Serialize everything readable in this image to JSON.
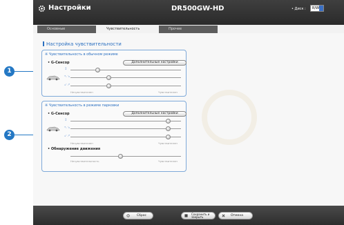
{
  "header": {
    "title": "Настройки",
    "model": "DR500GW-HD",
    "disk_label": "• Диск :",
    "disk_value": "R/W"
  },
  "tabs": [
    {
      "label": "Основные",
      "active": false
    },
    {
      "label": "Чувствительность",
      "active": true
    },
    {
      "label": "Прочее",
      "active": false
    }
  ],
  "page_title": "Настройка чувствительности",
  "panel_normal": {
    "title": "※ Чувствительность в обычном режиме",
    "gsensor_label": "• G-Сенсор",
    "advanced_button": "Дополнительные настройки",
    "axes": [
      "↕",
      "↖↘",
      "↙↗"
    ],
    "levels": [
      0.2,
      0.3,
      0.3
    ],
    "scale_low": "Нечувствителен",
    "scale_high": "Чувствителен"
  },
  "panel_parking": {
    "title": "※ Чувствительность в режиме парковки",
    "gsensor_label": "• G-Сенсор",
    "advanced_button": "Дополнительные настройки",
    "axes": [
      "↕",
      "↖↘",
      "↙↗"
    ],
    "levels": [
      0.85,
      0.85,
      0.85
    ],
    "scale_low": "Нечувствителен",
    "scale_high": "Чувствителен",
    "motion_label": "• Обнаружение движения",
    "motion_level": 0.45,
    "motion_scale_low": "Нечувствительность",
    "motion_scale_high": "Чувствителен"
  },
  "callouts": [
    "1",
    "2"
  ],
  "footer": {
    "reset": "Сброс",
    "save": "Сохранить и закрыть",
    "cancel": "Отмена"
  },
  "colors": {
    "accent": "#2a6fc0",
    "callout": "#2478c4",
    "panel_border": "#7ea9d9",
    "header_bg": "#333333"
  }
}
